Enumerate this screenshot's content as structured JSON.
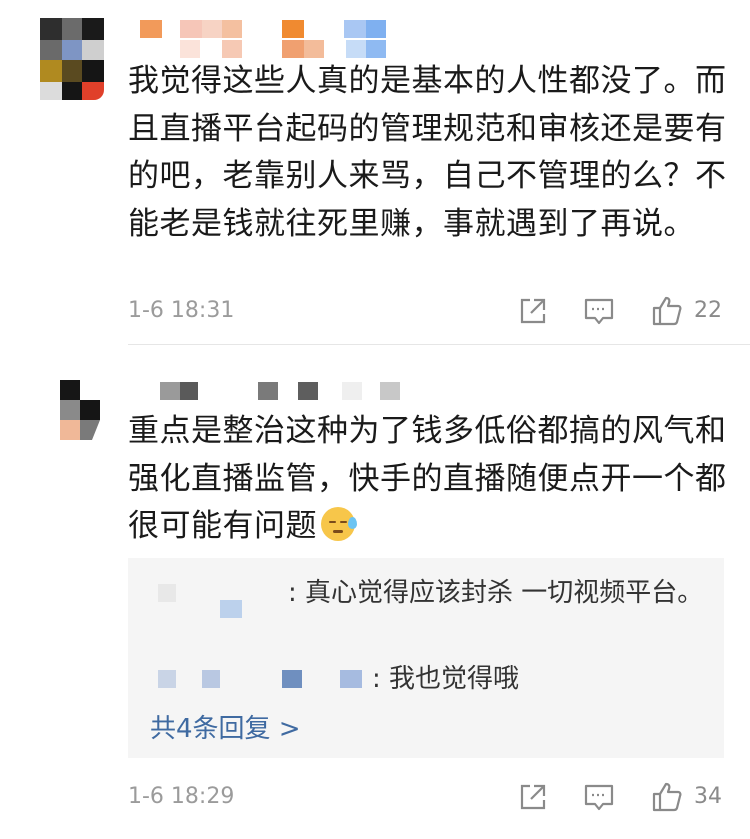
{
  "comments": [
    {
      "text": "我觉得这些人真的是基本的人性都没了。而且直播平台起码的管理规范和审核还是要有的吧，老靠别人来骂，自己不管理的么？不能老是钱就往死里赚，事就遇到了再说。",
      "time": "1-6 18:31",
      "likes": "22"
    },
    {
      "text": "重点是整治这种为了钱多低俗都搞的风气和强化直播监管，快手的直播随便点开一个都很可能有问题",
      "emoji": "cold-sweat-emoji",
      "time": "1-6 18:29",
      "likes": "34",
      "replies": [
        {
          "text": ": 真心觉得应该封杀 一切视频平台。"
        },
        {
          "text": ": 我也觉得哦"
        }
      ],
      "more_label": "共4条回复 >"
    }
  ],
  "icons": {
    "share": "share-icon",
    "comment": "comment-icon",
    "like": "thumbs-up-icon"
  },
  "colors": {
    "link": "#3f6aa1",
    "meta": "#9b9b9b",
    "reply_bg": "#f5f5f5"
  }
}
